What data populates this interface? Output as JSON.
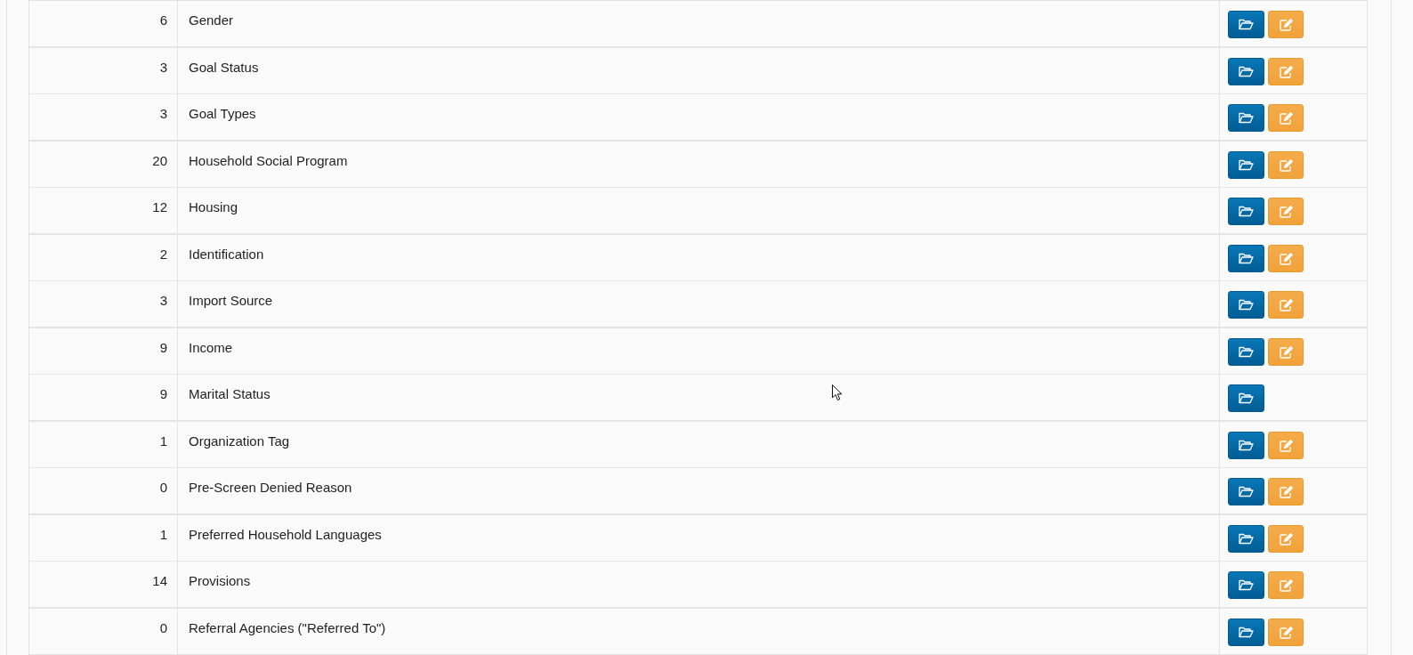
{
  "table": {
    "rows": [
      {
        "count": "6",
        "name": "Gender",
        "actions": [
          {
            "kind": "open"
          },
          {
            "kind": "edit"
          }
        ]
      },
      {
        "count": "3",
        "name": "Goal Status",
        "actions": [
          {
            "kind": "open"
          },
          {
            "kind": "edit"
          }
        ]
      },
      {
        "count": "3",
        "name": "Goal Types",
        "actions": [
          {
            "kind": "open"
          },
          {
            "kind": "edit"
          }
        ]
      },
      {
        "count": "20",
        "name": "Household Social Program",
        "actions": [
          {
            "kind": "open"
          },
          {
            "kind": "edit"
          }
        ]
      },
      {
        "count": "12",
        "name": "Housing",
        "actions": [
          {
            "kind": "open"
          },
          {
            "kind": "edit"
          }
        ]
      },
      {
        "count": "2",
        "name": "Identification",
        "actions": [
          {
            "kind": "open"
          },
          {
            "kind": "edit"
          }
        ]
      },
      {
        "count": "3",
        "name": "Import Source",
        "actions": [
          {
            "kind": "open"
          },
          {
            "kind": "edit"
          }
        ]
      },
      {
        "count": "9",
        "name": "Income",
        "actions": [
          {
            "kind": "open"
          },
          {
            "kind": "edit"
          }
        ]
      },
      {
        "count": "9",
        "name": "Marital Status",
        "actions": [
          {
            "kind": "open"
          }
        ]
      },
      {
        "count": "1",
        "name": "Organization Tag",
        "actions": [
          {
            "kind": "open"
          },
          {
            "kind": "edit"
          }
        ]
      },
      {
        "count": "0",
        "name": "Pre-Screen Denied Reason",
        "actions": [
          {
            "kind": "open"
          },
          {
            "kind": "edit"
          }
        ]
      },
      {
        "count": "1",
        "name": "Preferred Household Languages",
        "actions": [
          {
            "kind": "open"
          },
          {
            "kind": "edit"
          }
        ]
      },
      {
        "count": "14",
        "name": "Provisions",
        "actions": [
          {
            "kind": "open"
          },
          {
            "kind": "edit"
          }
        ]
      },
      {
        "count": "0",
        "name": "Referral Agencies (\"Referred To\")",
        "actions": [
          {
            "kind": "open"
          },
          {
            "kind": "edit"
          }
        ]
      }
    ]
  }
}
